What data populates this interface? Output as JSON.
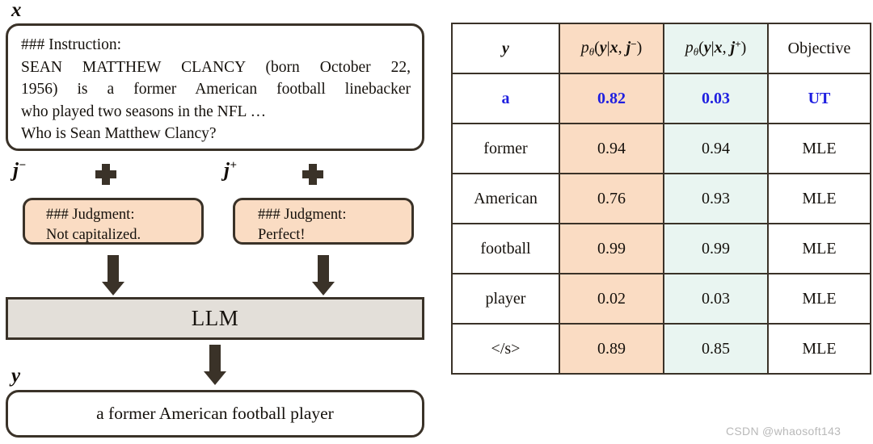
{
  "left_panel": {
    "input_label": "x",
    "instruction_box": {
      "line1": "### Instruction:",
      "line2": "SEAN MATTHEW CLANCY (born October 22,",
      "line3": "1956) is a former American football linebacker",
      "line4": "who played two seasons in the NFL …",
      "line5": "Who is Sean Matthew Clancy?"
    },
    "negative_judgment": {
      "label": "j",
      "label_sup": "−",
      "plus_icon": "plus-icon",
      "line1": "### Judgment:",
      "line2": "Not capitalized."
    },
    "positive_judgment": {
      "label": "j",
      "label_sup": "+",
      "plus_icon": "plus-icon",
      "line1": "### Judgment:",
      "line2": "Perfect!"
    },
    "model_box_label": "LLM",
    "output_label": "y",
    "output_text": "a former American football player",
    "arrow_icon": "arrow-down-icon"
  },
  "table": {
    "headers": {
      "y": "y",
      "p_neg": {
        "p": "p",
        "theta": "θ",
        "open": "(",
        "y": "y",
        "bar": "|",
        "x": "x",
        "comma": ", ",
        "j": "j",
        "sup": "−",
        "close": ")"
      },
      "p_pos": {
        "p": "p",
        "theta": "θ",
        "open": "(",
        "y": "y",
        "bar": "|",
        "x": "x",
        "comma": ", ",
        "j": "j",
        "sup": "+",
        "close": ")"
      },
      "objective": "Objective"
    },
    "rows": [
      {
        "token": "a",
        "p_neg": "0.82",
        "p_pos": "0.03",
        "objective": "UT",
        "highlight": true
      },
      {
        "token": "former",
        "p_neg": "0.94",
        "p_pos": "0.94",
        "objective": "MLE",
        "highlight": false
      },
      {
        "token": "American",
        "p_neg": "0.76",
        "p_pos": "0.93",
        "objective": "MLE",
        "highlight": false
      },
      {
        "token": "football",
        "p_neg": "0.99",
        "p_pos": "0.99",
        "objective": "MLE",
        "highlight": false
      },
      {
        "token": "player",
        "p_neg": "0.02",
        "p_pos": "0.03",
        "objective": "MLE",
        "highlight": false
      },
      {
        "token": "</s>",
        "p_neg": "0.89",
        "p_pos": "0.85",
        "objective": "MLE",
        "highlight": false
      }
    ]
  },
  "watermark": "CSDN @whaosoft143",
  "colors": {
    "negative_fill": "#FADCC3",
    "positive_fill": "#E9F5F1",
    "border_dark": "#3A3228",
    "model_box_fill": "#E3DFD9",
    "highlight_blue": "#1F1FE0",
    "watermark_grey": "#B9B9B9"
  }
}
